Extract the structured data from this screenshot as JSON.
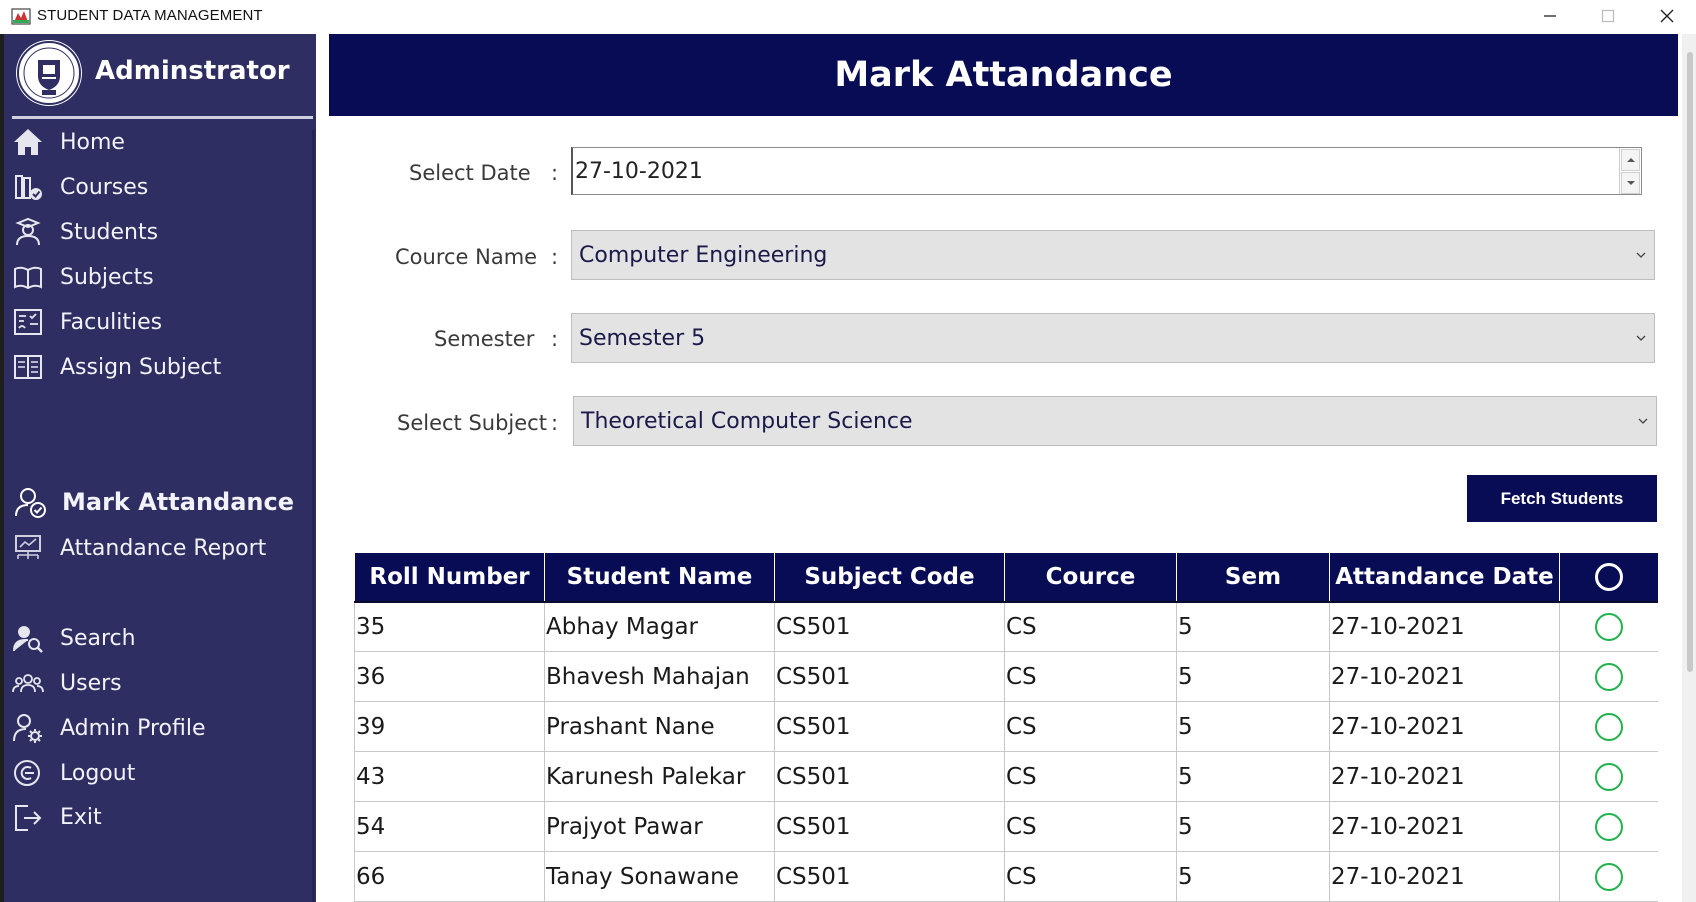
{
  "window": {
    "title": "STUDENT DATA MANAGEMENT"
  },
  "sidebar": {
    "brand": "Adminstrator",
    "items": [
      {
        "label": "Home",
        "icon": "home-icon"
      },
      {
        "label": "Courses",
        "icon": "courses-icon"
      },
      {
        "label": "Students",
        "icon": "student-icon"
      },
      {
        "label": "Subjects",
        "icon": "book-icon"
      },
      {
        "label": "Faculities",
        "icon": "faculty-icon"
      },
      {
        "label": "Assign Subject",
        "icon": "assign-icon"
      },
      {
        "label": "Mark Attandance",
        "icon": "mark-attendance-icon",
        "active": true
      },
      {
        "label": "Attandance Report",
        "icon": "report-icon"
      },
      {
        "label": "Search",
        "icon": "search-user-icon"
      },
      {
        "label": "Users",
        "icon": "users-icon"
      },
      {
        "label": "Admin Profile",
        "icon": "admin-settings-icon"
      },
      {
        "label": "Logout",
        "icon": "logout-icon"
      },
      {
        "label": "Exit",
        "icon": "exit-icon"
      }
    ]
  },
  "header": {
    "title": "Mark Attandance"
  },
  "form": {
    "date_label": "Select Date",
    "date_value": "27-10-2021",
    "course_label": "Cource Name",
    "course_value": "Computer Engineering",
    "semester_label": "Semester",
    "semester_value": "Semester 5",
    "subject_label": "Select Subject",
    "subject_value": "Theoretical Computer Science",
    "colon": ":",
    "fetch_label": "Fetch Students"
  },
  "table": {
    "columns": [
      "Roll Number",
      "Student Name",
      "Subject Code",
      "Cource",
      "Sem",
      "Attandance Date",
      ""
    ],
    "rows": [
      {
        "roll": "35",
        "name": "Abhay Magar",
        "code": "CS501",
        "course": "CS",
        "sem": "5",
        "date": "27-10-2021"
      },
      {
        "roll": "36",
        "name": "Bhavesh Mahajan",
        "code": "CS501",
        "course": "CS",
        "sem": "5",
        "date": "27-10-2021"
      },
      {
        "roll": "39",
        "name": "Prashant Nane",
        "code": "CS501",
        "course": "CS",
        "sem": "5",
        "date": "27-10-2021"
      },
      {
        "roll": "43",
        "name": "Karunesh Palekar",
        "code": "CS501",
        "course": "CS",
        "sem": "5",
        "date": "27-10-2021"
      },
      {
        "roll": "54",
        "name": "Prajyot Pawar",
        "code": "CS501",
        "course": "CS",
        "sem": "5",
        "date": "27-10-2021"
      },
      {
        "roll": "66",
        "name": "Tanay Sonawane",
        "code": "CS501",
        "course": "CS",
        "sem": "5",
        "date": "27-10-2021"
      }
    ]
  },
  "colors": {
    "sidebar_bg": "#2e2e62",
    "header_bg": "#080c55",
    "radio_green": "#22b24c"
  }
}
